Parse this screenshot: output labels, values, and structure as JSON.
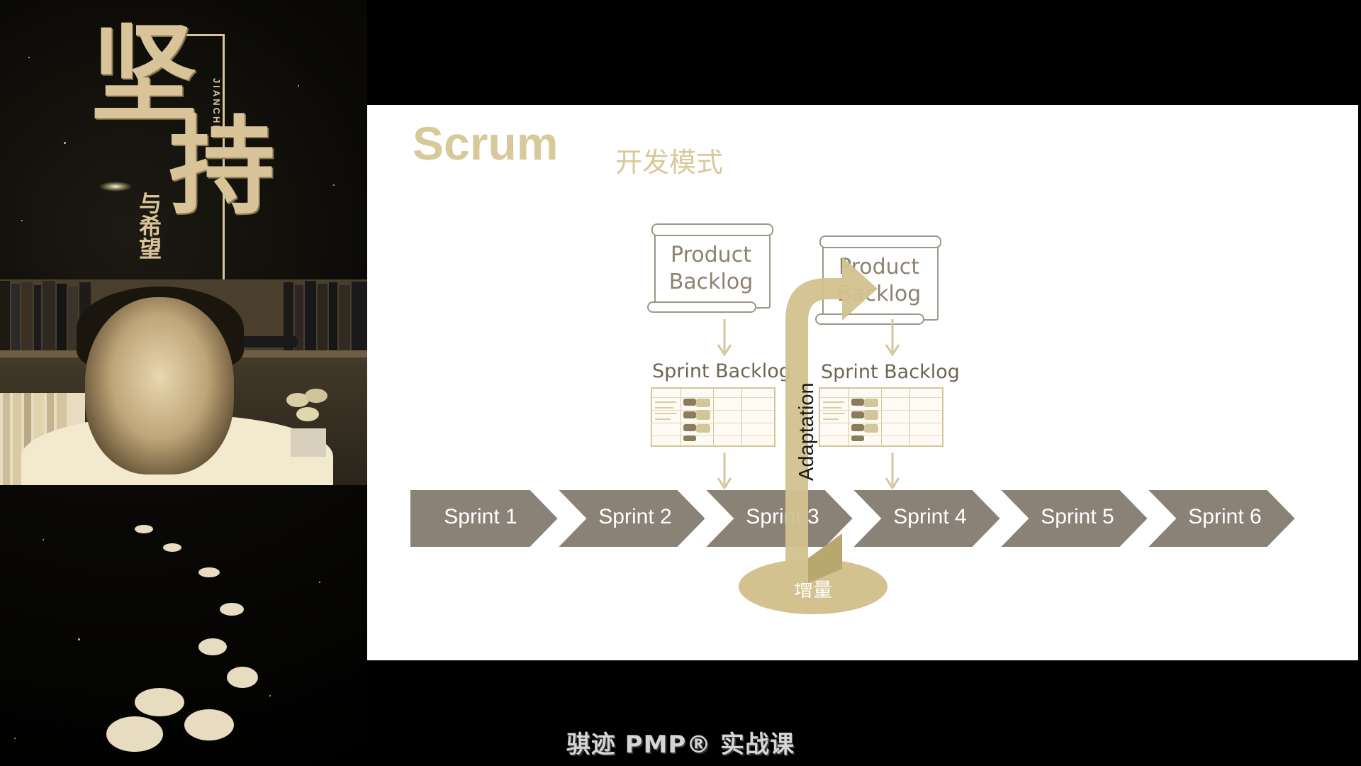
{
  "left_panel": {
    "calligraphy": [
      "坚",
      "持"
    ],
    "pinyin": "JIANCHI",
    "sub_calligraphy": "与希望"
  },
  "slide": {
    "title": "Scrum",
    "subtitle": "开发模式",
    "product_backlog_1": "Product Backlog",
    "product_backlog_2": "Product Backlog",
    "sprint_backlog_1": "Sprint Backlog",
    "sprint_backlog_2": "Sprint Backlog",
    "sprints": [
      "Sprint 1",
      "Sprint 2",
      "Sprint 3",
      "Sprint 4",
      "Sprint 5",
      "Sprint 6"
    ],
    "adaptation": "Adaptation",
    "increment": "增量"
  },
  "watermark": "骐迹 PMP® 实战课",
  "colors": {
    "gold": "#d8c99a",
    "sprint_gray": "#8a8276",
    "background": "#000000"
  }
}
